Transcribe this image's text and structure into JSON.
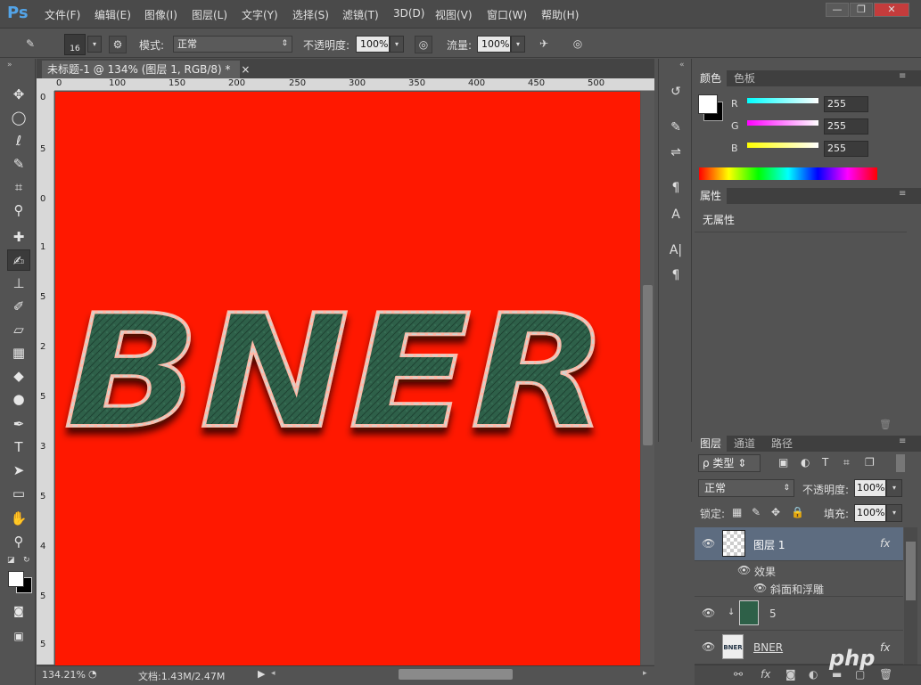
{
  "app": {
    "logo": "Ps"
  },
  "menu": [
    "文件(F)",
    "编辑(E)",
    "图像(I)",
    "图层(L)",
    "文字(Y)",
    "选择(S)",
    "滤镜(T)",
    "3D(D)",
    "视图(V)",
    "窗口(W)",
    "帮助(H)"
  ],
  "window_controls": {
    "minimize": "—",
    "restore": "❐",
    "close": "✕"
  },
  "options": {
    "brush_size": "16",
    "mode_label": "模式:",
    "mode_value": "正常",
    "opacity_label": "不透明度:",
    "opacity_value": "100%",
    "flow_label": "流量:",
    "flow_value": "100%"
  },
  "document": {
    "tab_title": "未标题-1 @ 134% (图层 1, RGB/8) *",
    "tab_close": "×",
    "zoom": "134.21%",
    "doc_info": "文档:1.43M/2.47M",
    "canvas_text": "BNER",
    "canvas_color": "#ff1800"
  },
  "ruler": {
    "h_ticks": [
      "0",
      "100",
      "150",
      "200",
      "250",
      "300",
      "350",
      "400",
      "450",
      "500"
    ],
    "v_ticks": [
      "0",
      "5",
      "0",
      "1",
      "5",
      "2",
      "5",
      "3",
      "5",
      "4",
      "5",
      "5"
    ]
  },
  "color_panel": {
    "tabs": [
      "颜色",
      "色板"
    ],
    "r_label": "R",
    "r_value": "255",
    "g_label": "G",
    "g_value": "255",
    "b_label": "B",
    "b_value": "255"
  },
  "properties_panel": {
    "tab": "属性",
    "content": "无属性"
  },
  "layers_panel": {
    "tabs": [
      "图层",
      "通道",
      "路径"
    ],
    "filter_label": "ρ 类型",
    "blend_mode": "正常",
    "opacity_label": "不透明度:",
    "opacity_value": "100%",
    "lock_label": "锁定:",
    "fill_label": "填充:",
    "fill_value": "100%",
    "layers": [
      {
        "name": "图层 1",
        "fx": "fx",
        "selected": true
      },
      {
        "name": "效果",
        "sub": true
      },
      {
        "name": "斜面和浮雕",
        "sub2": true
      },
      {
        "name": "5"
      },
      {
        "name": "BNER",
        "fx": "fx"
      }
    ]
  },
  "watermark": "php"
}
